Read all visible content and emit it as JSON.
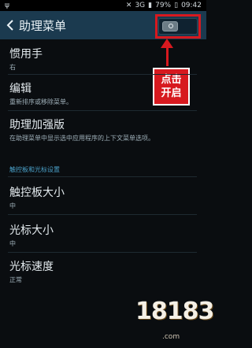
{
  "status": {
    "battery": "79%",
    "time": "09:42",
    "signal": "3G"
  },
  "header": {
    "title": "助理菜单"
  },
  "callout": {
    "line1": "点击",
    "line2": "开启"
  },
  "items": [
    {
      "label": "惯用手",
      "sub": "右"
    },
    {
      "label": "编辑",
      "sub": "重新排序或移除菜单。"
    },
    {
      "label": "助理加强版",
      "sub": "在助理菜单中显示选中应用程序的上下文菜单选项。"
    }
  ],
  "section": {
    "title": "触控板和光标设置"
  },
  "settings": [
    {
      "label": "触控板大小",
      "sub": "中"
    },
    {
      "label": "光标大小",
      "sub": "中"
    },
    {
      "label": "光标速度",
      "sub": "正常"
    }
  ],
  "watermark": {
    "brand": "18183",
    "domain": ".com"
  }
}
